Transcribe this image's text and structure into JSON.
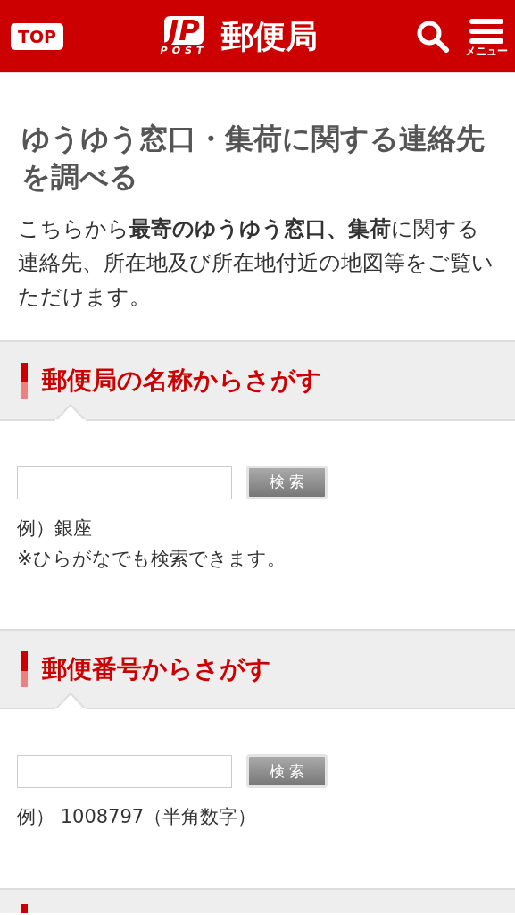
{
  "header": {
    "top_button": "TOP",
    "logo_mark": "JP",
    "logo_sub": "POST",
    "site_name": "郵便局",
    "menu_label": "メニュー"
  },
  "page_title": "ゆうゆう窓口・集荷に関する連絡先を調べる",
  "intro": "こちらから**最寄のゆうゆう窓口、集荷**に関する連絡先、所在地及び所在地付近の地図等をご覧いただけます。",
  "sections": [
    {
      "title": "郵便局の名称からさがす",
      "search_button": "検 索",
      "notes": [
        "例）銀座",
        "※ひらがなでも検索できます。"
      ]
    },
    {
      "title": "郵便番号からさがす",
      "search_button": "検 索",
      "notes": [
        "例） 1008797（半角数字）"
      ]
    }
  ],
  "next_section_partly_visible": true
}
